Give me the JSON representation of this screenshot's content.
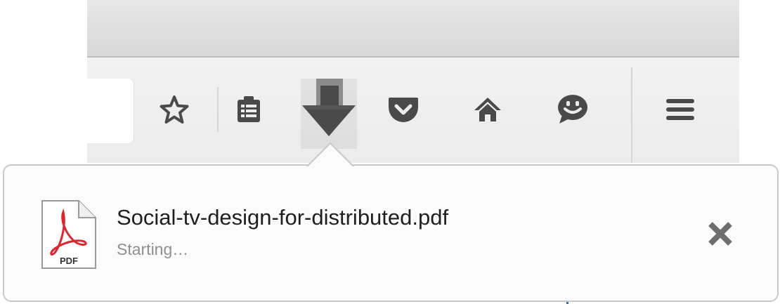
{
  "toolbar": {
    "buttons": [
      {
        "name": "bookmark",
        "icon": "star-icon"
      },
      {
        "name": "reading-list",
        "icon": "clipboard-list-icon"
      },
      {
        "name": "downloads",
        "icon": "download-arrow-icon"
      },
      {
        "name": "pocket",
        "icon": "pocket-icon"
      },
      {
        "name": "home",
        "icon": "home-icon"
      },
      {
        "name": "chat",
        "icon": "smiley-chat-icon"
      },
      {
        "name": "menu",
        "icon": "hamburger-menu-icon"
      }
    ]
  },
  "download": {
    "file_name": "Social-tv-design-for-distributed.pdf",
    "status": "Starting…",
    "file_type_label": "PDF",
    "file_icon": "pdf-file-icon",
    "cancel_icon": "close-icon"
  },
  "colors": {
    "icon": "#4a4a4a",
    "file_name": "#1f1f1f",
    "status": "#8f8f8f",
    "acrobat_red": "#d9282f"
  }
}
